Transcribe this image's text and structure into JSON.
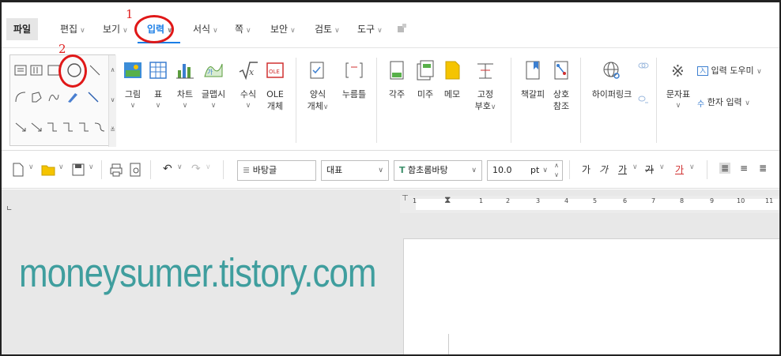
{
  "menu": {
    "file": "파일",
    "items": [
      {
        "label": "편집"
      },
      {
        "label": "보기"
      },
      {
        "label": "입력",
        "active": true
      },
      {
        "label": "서식"
      },
      {
        "label": "쪽"
      },
      {
        "label": "보안"
      },
      {
        "label": "검토"
      },
      {
        "label": "도구"
      }
    ]
  },
  "annotations": {
    "step1": "1",
    "step2": "2",
    "color": "#e01818"
  },
  "ribbon": {
    "buttons": {
      "picture": "그림",
      "table": "표",
      "chart": "차트",
      "wordart": "글맵시",
      "formula": "수식",
      "ole_line1": "OLE",
      "ole_line2": "개체",
      "form_line1": "양식",
      "form_line2": "개체",
      "press_button": "누름틀",
      "footnote": "각주",
      "endnote": "미주",
      "memo": "메모",
      "fixed_line1": "고정",
      "fixed_line2": "부호",
      "bookmark": "책갈피",
      "cross_line1": "상호",
      "cross_line2": "참조",
      "hyperlink": "하이퍼링크",
      "symbol": "문자표",
      "input_helper": "입력 도우미",
      "hanja_input": "한자 입력"
    }
  },
  "toolbar": {
    "style": "바탕글",
    "heading": "대표",
    "font": "함초롬바탕",
    "size": "10.0",
    "unit": "pt",
    "fmt": [
      "가",
      "가",
      "가",
      "가"
    ]
  },
  "ruler": {
    "ticks": [
      "1",
      "1",
      "2",
      "3",
      "4",
      "5",
      "6",
      "7",
      "8",
      "9",
      "10",
      "11"
    ]
  },
  "watermark": "moneysumer.tistory.com",
  "colors": {
    "accent": "#1a7ee6",
    "watermark": "#3f9e9e"
  }
}
